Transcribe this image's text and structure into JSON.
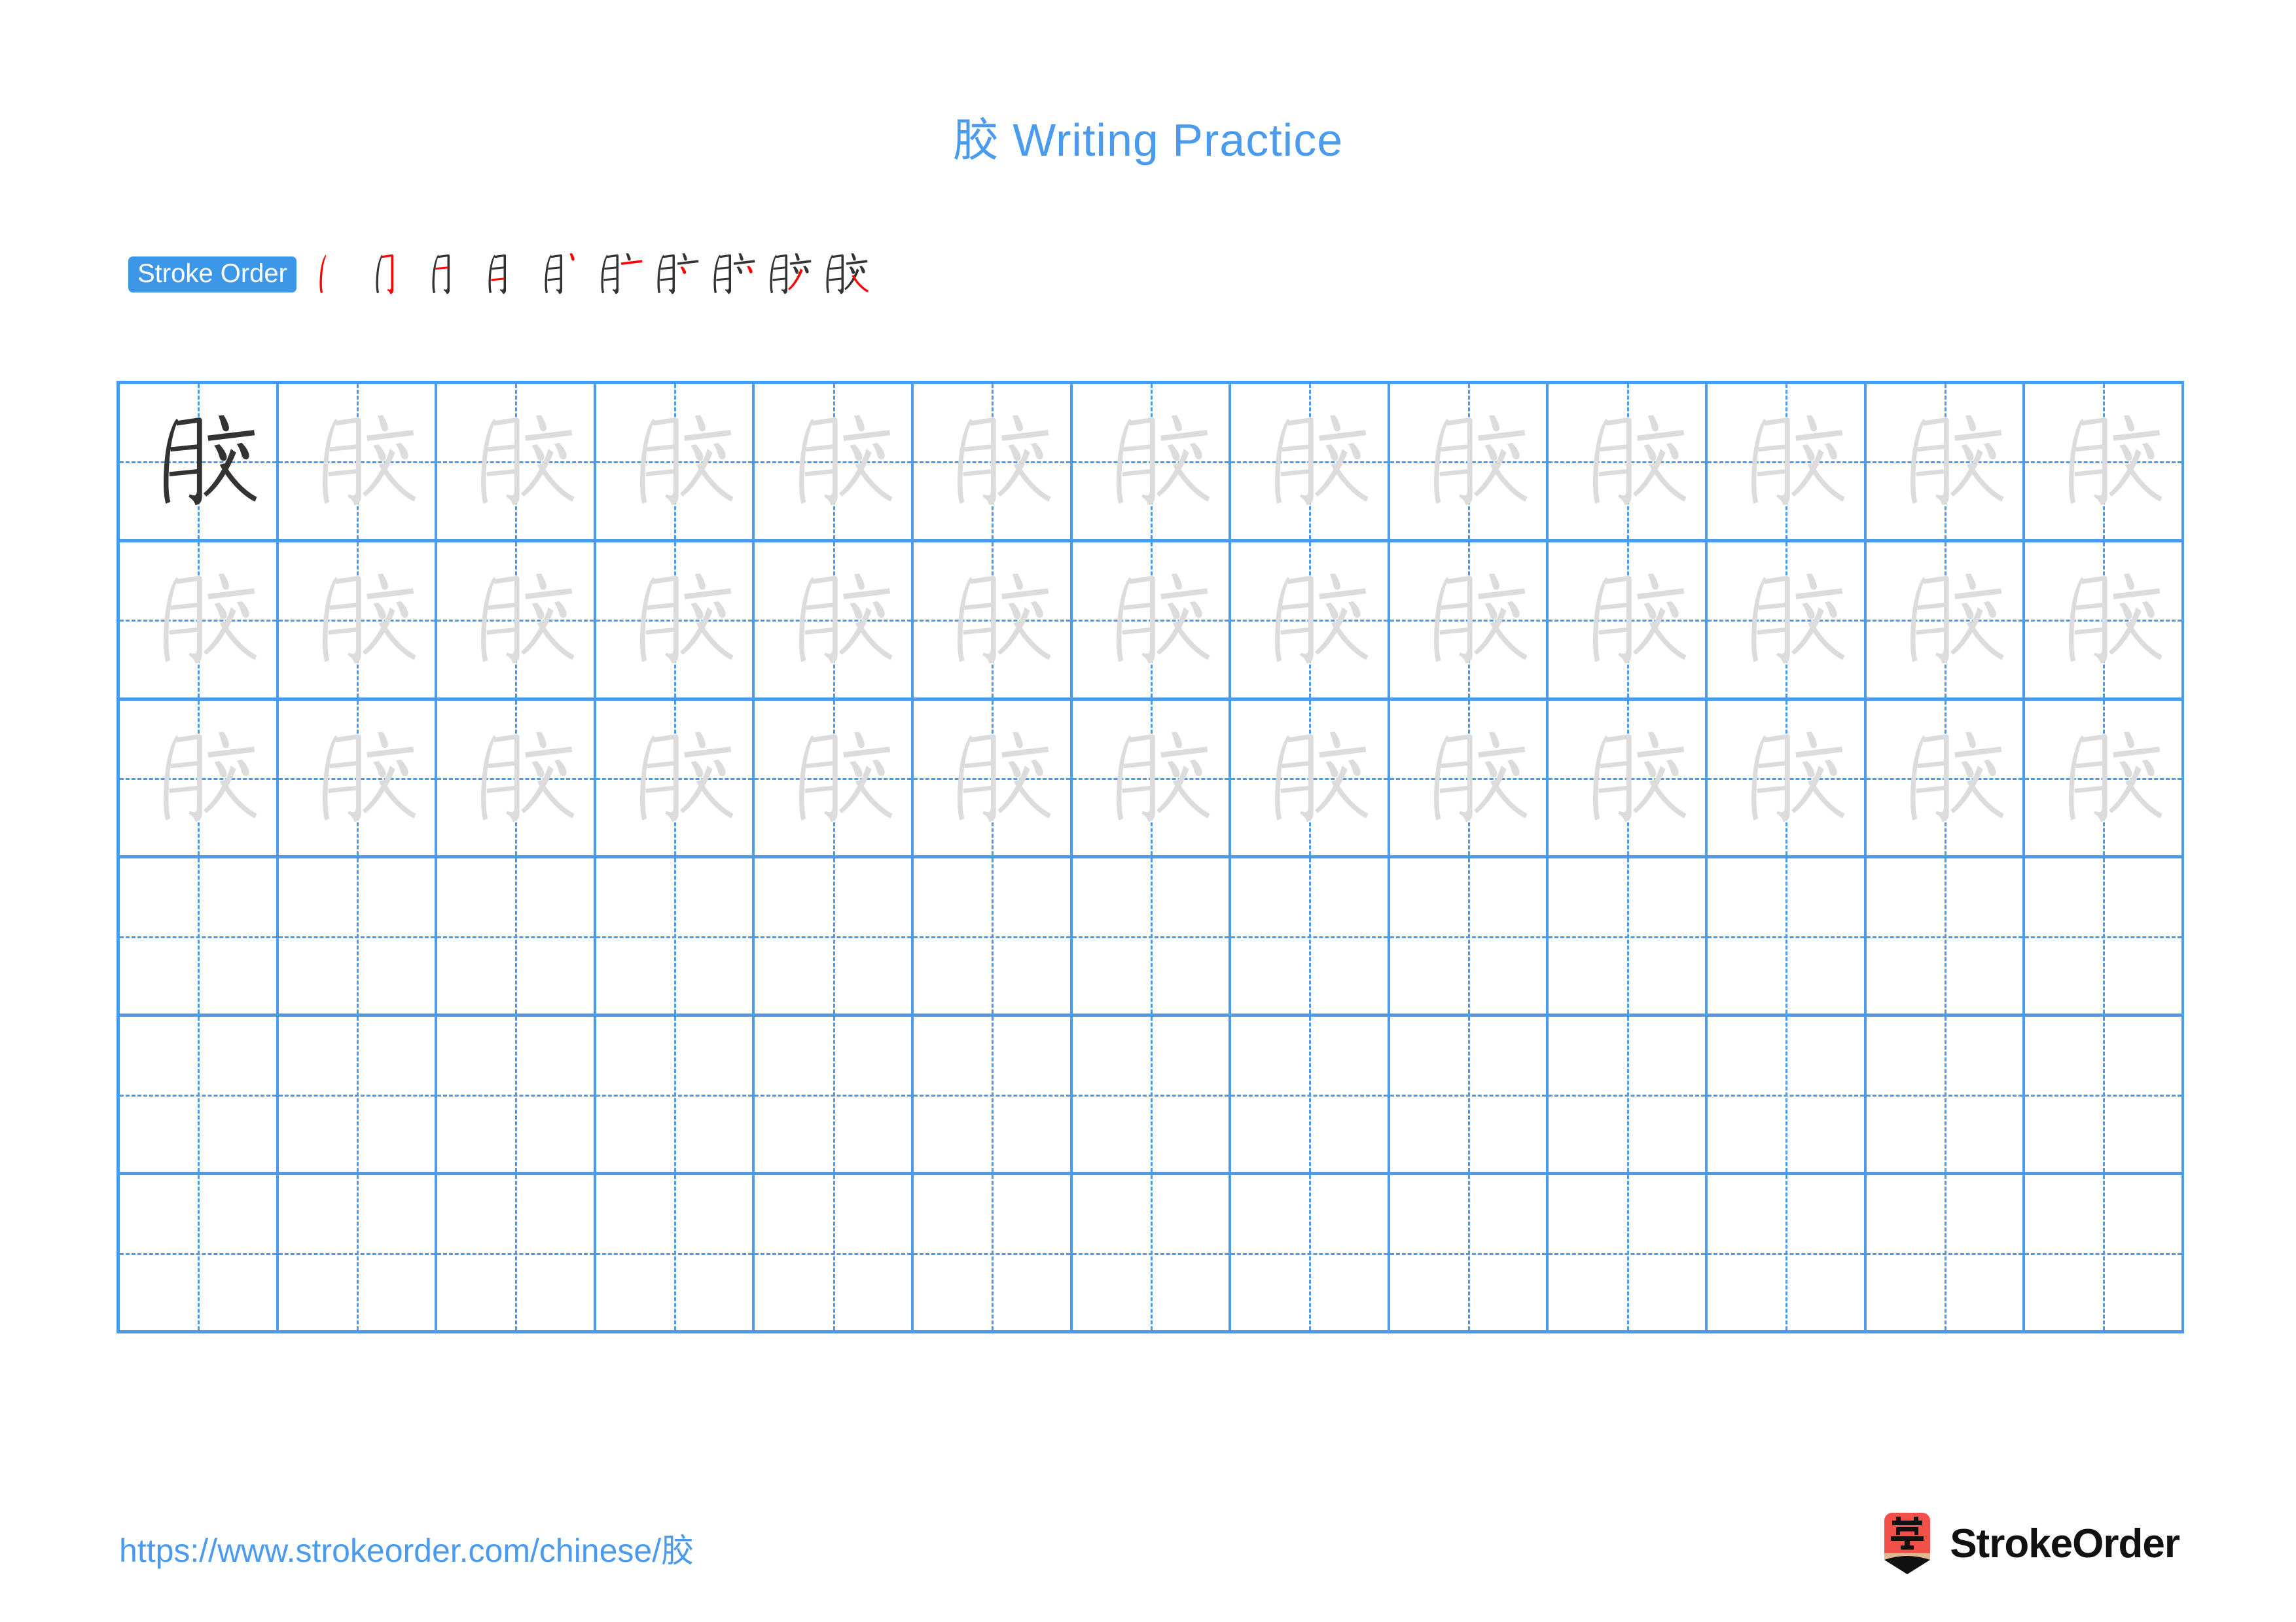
{
  "page": {
    "character": "胶",
    "title": "胶 Writing Practice",
    "title_color": "#4a9bee",
    "background": "#ffffff"
  },
  "stroke_order": {
    "badge_label": "Stroke Order",
    "badge_color": "#3d97e8",
    "badge_text_color": "#ffffff",
    "new_stroke_color": "#ff0000",
    "existing_stroke_color": "#333333",
    "stroke_count": 10,
    "steps": [
      {
        "index": 1,
        "glyph": "丿",
        "new_stroke": "丿"
      },
      {
        "index": 2,
        "glyph": "刀",
        "new_stroke": "㇆"
      },
      {
        "index": 3,
        "glyph": "月",
        "new_stroke": "一"
      },
      {
        "index": 4,
        "glyph": "月",
        "new_stroke": "一"
      },
      {
        "index": 5,
        "glyph": "月丶",
        "new_stroke": "丶"
      },
      {
        "index": 6,
        "glyph": "肀",
        "new_stroke": "一"
      },
      {
        "index": 7,
        "glyph": "肑",
        "new_stroke": "丿"
      },
      {
        "index": 8,
        "glyph": "肸",
        "new_stroke": "丿"
      },
      {
        "index": 9,
        "glyph": "肹",
        "new_stroke": "㇇"
      },
      {
        "index": 10,
        "glyph": "胶",
        "new_stroke": "㇏"
      }
    ]
  },
  "grid": {
    "columns": 13,
    "rows": 6,
    "line_color": "#4a9bee",
    "guide_char_color": "#dcdcdc",
    "model_char_color": "#333333",
    "row_fill": [
      {
        "row": 1,
        "cells": [
          "model",
          "guide",
          "guide",
          "guide",
          "guide",
          "guide",
          "guide",
          "guide",
          "guide",
          "guide",
          "guide",
          "guide",
          "guide"
        ]
      },
      {
        "row": 2,
        "cells": [
          "guide",
          "guide",
          "guide",
          "guide",
          "guide",
          "guide",
          "guide",
          "guide",
          "guide",
          "guide",
          "guide",
          "guide",
          "guide"
        ]
      },
      {
        "row": 3,
        "cells": [
          "guide",
          "guide",
          "guide",
          "guide",
          "guide",
          "guide",
          "guide",
          "guide",
          "guide",
          "guide",
          "guide",
          "guide",
          "guide"
        ]
      },
      {
        "row": 4,
        "cells": [
          "empty",
          "empty",
          "empty",
          "empty",
          "empty",
          "empty",
          "empty",
          "empty",
          "empty",
          "empty",
          "empty",
          "empty",
          "empty"
        ]
      },
      {
        "row": 5,
        "cells": [
          "empty",
          "empty",
          "empty",
          "empty",
          "empty",
          "empty",
          "empty",
          "empty",
          "empty",
          "empty",
          "empty",
          "empty",
          "empty"
        ]
      },
      {
        "row": 6,
        "cells": [
          "empty",
          "empty",
          "empty",
          "empty",
          "empty",
          "empty",
          "empty",
          "empty",
          "empty",
          "empty",
          "empty",
          "empty",
          "empty"
        ]
      }
    ]
  },
  "footer": {
    "url": "https://www.strokeorder.com/chinese/胶",
    "url_color": "#4a9bee",
    "brand_name": "StrokeOrder",
    "logo_char": "字",
    "logo_body_color": "#f4504a",
    "logo_wood_color": "#e0b894",
    "logo_tip_color": "#111111"
  }
}
